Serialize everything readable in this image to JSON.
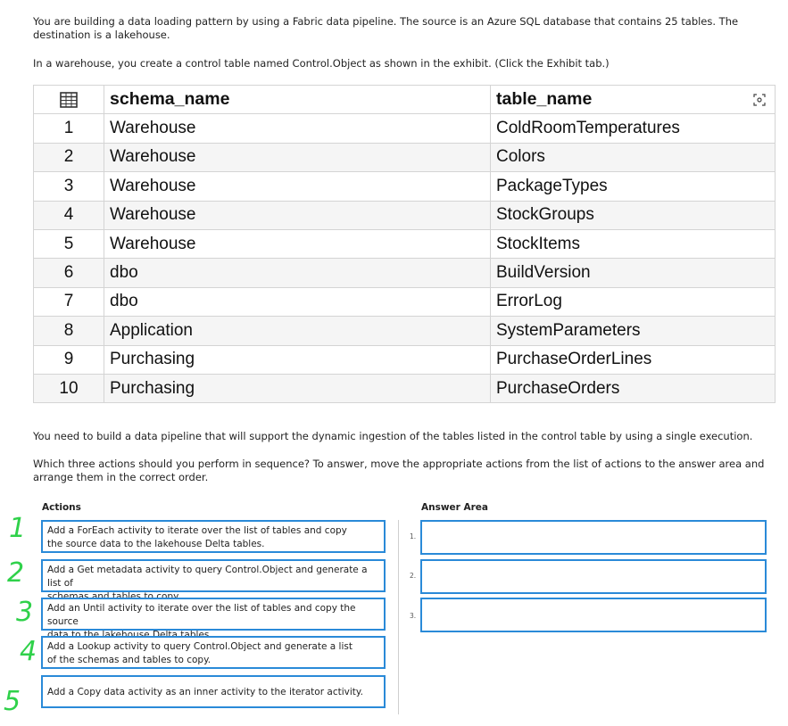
{
  "question": {
    "intro": "You are building a data loading pattern by using a Fabric data pipeline. The source is an Azure SQL database that contains 25 tables. The destination is a lakehouse.",
    "warehouse_line": "In a warehouse, you create a control table named Control.Object as shown in the exhibit. (Click the Exhibit tab.)",
    "need_line": "You need to build a data pipeline that will support the dynamic ingestion of the tables listed in the control table by using a single execution.",
    "which_line": "Which three actions should you perform in sequence? To answer, move the appropriate actions from the list of actions to the answer area and arrange them in the correct order."
  },
  "exhibit": {
    "headers": [
      "schema_name",
      "table_name"
    ],
    "rows": [
      {
        "n": "1",
        "schema": "Warehouse",
        "table": "ColdRoomTemperatures"
      },
      {
        "n": "2",
        "schema": "Warehouse",
        "table": "Colors"
      },
      {
        "n": "3",
        "schema": "Warehouse",
        "table": "PackageTypes"
      },
      {
        "n": "4",
        "schema": "Warehouse",
        "table": "StockGroups"
      },
      {
        "n": "5",
        "schema": "Warehouse",
        "table": "StockItems"
      },
      {
        "n": "6",
        "schema": "dbo",
        "table": "BuildVersion"
      },
      {
        "n": "7",
        "schema": "dbo",
        "table": "ErrorLog"
      },
      {
        "n": "8",
        "schema": "Application",
        "table": "SystemParameters"
      },
      {
        "n": "9",
        "schema": "Purchasing",
        "table": "PurchaseOrderLines"
      },
      {
        "n": "10",
        "schema": "Purchasing",
        "table": "PurchaseOrders"
      }
    ]
  },
  "actions": {
    "label": "Actions",
    "items": [
      {
        "l1": "Add a ForEach activity to iterate over the list of tables and copy",
        "l2": "the source data to the lakehouse Delta tables."
      },
      {
        "l1": "Add a Get metadata activity to query Control.Object and generate a list of",
        "l2": "schemas and tables to copy."
      },
      {
        "l1": "Add an Until activity to iterate over the list of tables and copy the source",
        "l2": "data to the lakehouse Delta tables."
      },
      {
        "l1": "Add a Lookup activity to query Control.Object and generate a list",
        "l2": "of the schemas and tables to copy."
      },
      {
        "l1": "Add a Copy data activity as an inner activity to the iterator activity.",
        "l2": ""
      }
    ]
  },
  "answer_area": {
    "label": "Answer Area",
    "slots": [
      "1.",
      "2.",
      "3."
    ]
  },
  "handwritten_numbers": [
    "1",
    "2",
    "3",
    "4",
    "5"
  ],
  "colors": {
    "box_border": "#2a8ad8",
    "handwriting": "#2fd14a"
  }
}
